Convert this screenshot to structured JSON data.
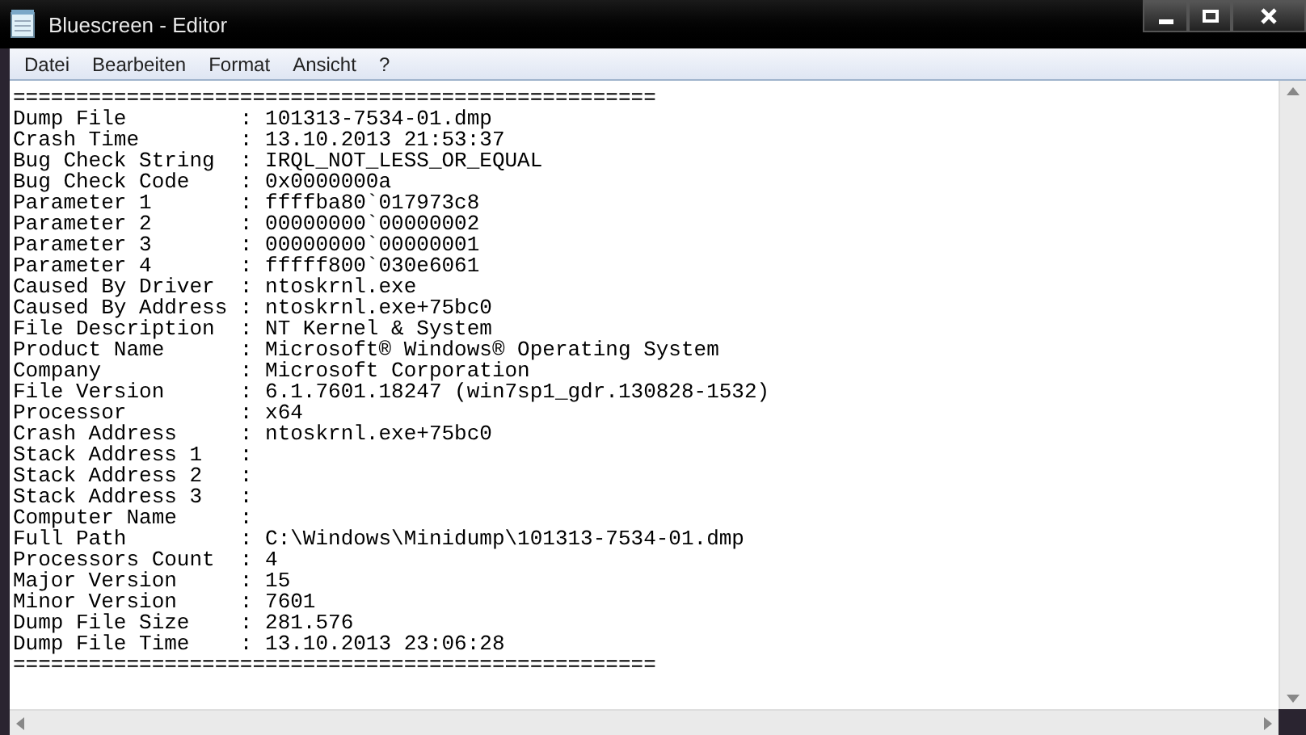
{
  "window": {
    "title": "Bluescreen - Editor"
  },
  "menu": [
    "Datei",
    "Bearbeiten",
    "Format",
    "Ansicht",
    "?"
  ],
  "lines": [
    "===================================================",
    "Dump File         : 101313-7534-01.dmp",
    "Crash Time        : 13.10.2013 21:53:37",
    "Bug Check String  : IRQL_NOT_LESS_OR_EQUAL",
    "Bug Check Code    : 0x0000000a",
    "Parameter 1       : ffffba80`017973c8",
    "Parameter 2       : 00000000`00000002",
    "Parameter 3       : 00000000`00000001",
    "Parameter 4       : fffff800`030e6061",
    "Caused By Driver  : ntoskrnl.exe",
    "Caused By Address : ntoskrnl.exe+75bc0",
    "File Description  : NT Kernel & System",
    "Product Name      : Microsoft® Windows® Operating System",
    "Company           : Microsoft Corporation",
    "File Version      : 6.1.7601.18247 (win7sp1_gdr.130828-1532)",
    "Processor         : x64",
    "Crash Address     : ntoskrnl.exe+75bc0",
    "Stack Address 1   :",
    "Stack Address 2   :",
    "Stack Address 3   :",
    "Computer Name     :",
    "Full Path         : C:\\Windows\\Minidump\\101313-7534-01.dmp",
    "Processors Count  : 4",
    "Major Version     : 15",
    "Minor Version     : 7601",
    "Dump File Size    : 281.576",
    "Dump File Time    : 13.10.2013 23:06:28",
    "==================================================="
  ]
}
